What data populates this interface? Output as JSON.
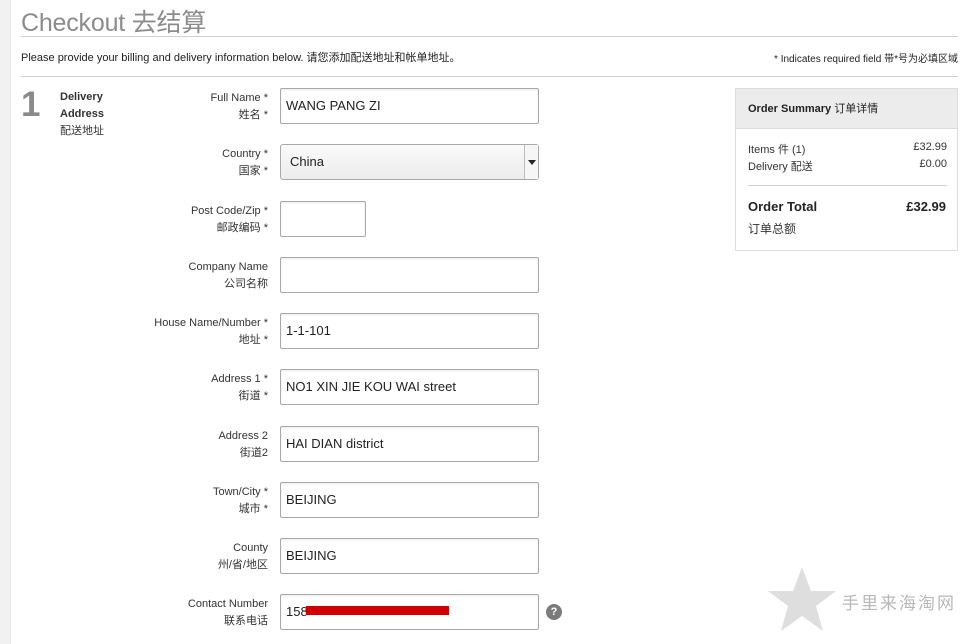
{
  "page": {
    "title": "Checkout 去结算",
    "intro": "Please provide your billing and delivery information below. 请您添加配送地址和帐单地址。",
    "required_note": "* Indicates required field 带*号为必填区域"
  },
  "step": {
    "number": "1",
    "label_en": "Delivery Address",
    "label_zh": "配送地址"
  },
  "form": {
    "full_name": {
      "label_en": "Full Name *",
      "label_zh": "姓名 *",
      "value": "WANG PANG ZI"
    },
    "country": {
      "label_en": "Country *",
      "label_zh": "国家 *",
      "value": "China"
    },
    "post_code": {
      "label_en": "Post Code/Zip *",
      "label_zh": "邮政编码 *",
      "value": ""
    },
    "company": {
      "label_en": "Company Name",
      "label_zh": "公司名称",
      "value": ""
    },
    "house": {
      "label_en": "House Name/Number *",
      "label_zh": "地址 *",
      "value": "1-1-101"
    },
    "address1": {
      "label_en": "Address 1 *",
      "label_zh": "街道 *",
      "value": "NO1 XIN JIE KOU WAI street"
    },
    "address2": {
      "label_en": "Address 2",
      "label_zh": "街道2",
      "value": "HAI DIAN district"
    },
    "town": {
      "label_en": "Town/City *",
      "label_zh": "城市 *",
      "value": "BEIJING"
    },
    "county": {
      "label_en": "County",
      "label_zh": "州/省/地区",
      "value": "BEIJING"
    },
    "contact": {
      "label_en": "Contact Number",
      "label_zh": "联系电话",
      "value": "158",
      "help_icon": "?"
    }
  },
  "summary": {
    "title_en": "Order Summary",
    "title_zh": "订单详情",
    "items_label": "Items 件 (1)",
    "items_value": "£32.99",
    "delivery_label": "Delivery 配送",
    "delivery_value": "£0.00",
    "total_label_en": "Order Total",
    "total_label_zh": "订单总额",
    "total_value": "£32.99"
  },
  "watermark": {
    "text": "手里来海淘网",
    "icon": "star-icon"
  },
  "colors": {
    "redaction": "#d10000",
    "title_gray": "#8c8c8c",
    "panel_head": "#ececec"
  }
}
